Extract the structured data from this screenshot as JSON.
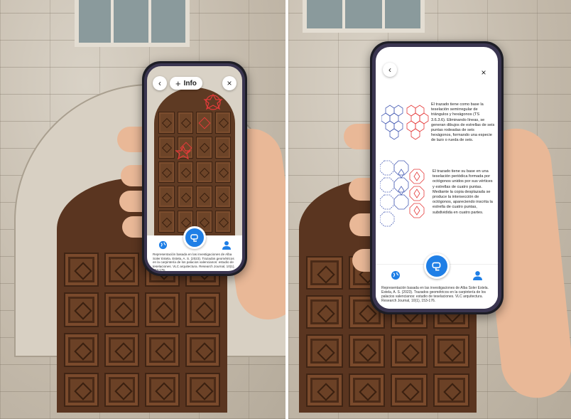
{
  "left_phone": {
    "back_icon": "chevron-left-icon",
    "info_label": "Info",
    "close_label": "×",
    "credit_text": "Representación basada en las investigaciones de Alba Soler Estela. Estela, A. S. (2023). Trazados geométricos en la carpintería de los palacios valencianos: estudio de teselaciones. VLC arquitectura. Research Journal, 10(1), 153-176.",
    "nav_icons": [
      "globe-icon",
      "ar-scan-icon",
      "user-icon"
    ]
  },
  "right_phone": {
    "back_icon": "chevron-left-icon",
    "close_label": "×",
    "desc_1": "El trazado tiene como base la teselación semirregular de triángulos y hexágonos (TS 3.6.3.6). Eliminando líneas, se generan dibujos de estrellas de seis puntas rodeadas de seis hexágonos, formando una especie de lazo o rueda de seis.",
    "desc_2": "El trazado tiene su base en una teselación periódica formada por octógonos unidos por sus vértices y estrellas de cuatro puntas. Mediante la copia desplazada se produce la intersección de octógonos, apareciendo inscrita la estrella de cuatro puntas, subdividida en cuatro partes.",
    "credit_text": "Representación basada en las investigaciones de Alba Soler Estela. Estela, A. S. (2023). Trazados geométricos en la carpintería de los palacios valencianos: estudio de teselaciones. VLC arquitectura. Research Journal, 10(1), 153-176.",
    "nav_icons": [
      "globe-icon",
      "ar-scan-icon",
      "user-icon"
    ]
  },
  "colors": {
    "accent_blue": "#1f7fe6",
    "pattern_red": "#e53a3a",
    "pattern_blue": "#4a5fb5",
    "door_wood": "#5a3520"
  }
}
